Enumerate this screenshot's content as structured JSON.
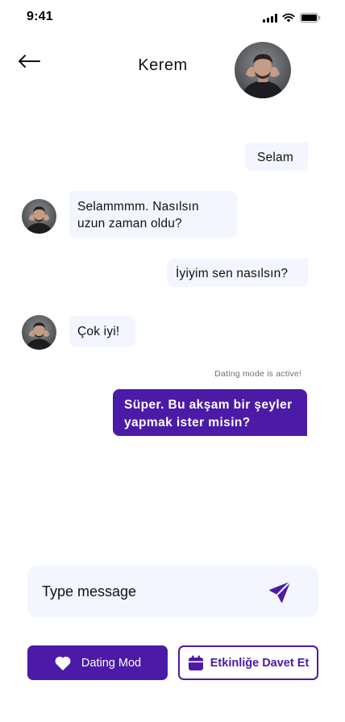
{
  "status_bar": {
    "time": "9:41",
    "icons": [
      "signal-icon",
      "wifi-icon",
      "battery-icon"
    ]
  },
  "header": {
    "contact_name": "Kerem",
    "back_icon": "arrow-left-icon"
  },
  "messages": [
    {
      "side": "right",
      "text": "Selam"
    },
    {
      "side": "left",
      "text": "Selammmm. Nasılsın uzun zaman oldu?"
    },
    {
      "side": "right",
      "text": "İyiyim sen nasılsın?"
    },
    {
      "side": "left",
      "text": "Çok iyi!"
    },
    {
      "side": "right",
      "style": "accent",
      "text": "Süper. Bu akşam bir şeyler yapmak ister misin?"
    }
  ],
  "dating_note": "Dating mode is active!",
  "composer": {
    "placeholder": "Type message",
    "send_icon": "send-icon"
  },
  "actions": {
    "dating_mode_label": "Dating Mod",
    "dating_mode_icon": "heart-icon",
    "invite_label": "Etkinliğe Davet Et",
    "invite_icon": "calendar-icon"
  },
  "colors": {
    "accent": "#4b1aa6",
    "bubble_bg": "#f4f6ff",
    "text": "#111111",
    "muted": "#6e6e6e"
  }
}
